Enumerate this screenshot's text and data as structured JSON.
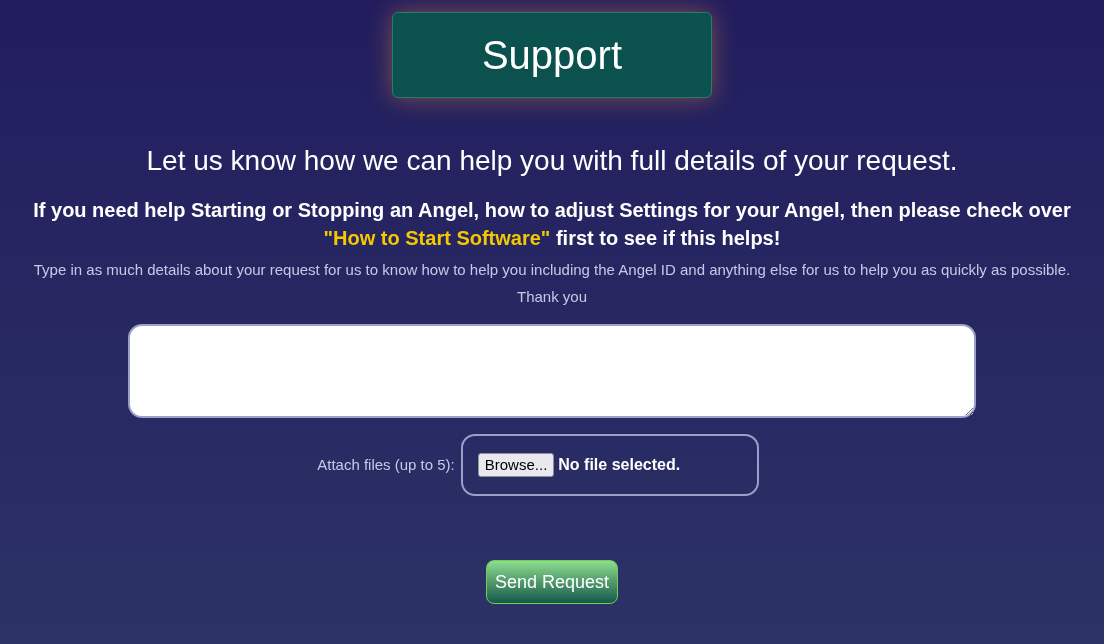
{
  "title": "Support",
  "heading": "Let us know how we can help you with full details of your request.",
  "help": {
    "before": "If you need help Starting or Stopping an Angel, how to adjust Settings for your Angel, then please check over ",
    "link": "\"How to Start Software\"",
    "after": " first to see if this helps!"
  },
  "instructions": "Type in as much details about your request for us to know how to help you including the Angel ID and anything else for us to help you as quickly as possible. Thank you",
  "attach": {
    "label": "Attach files (up to 5):",
    "button": "Browse...",
    "status": "No file selected."
  },
  "submit": "Send Request"
}
